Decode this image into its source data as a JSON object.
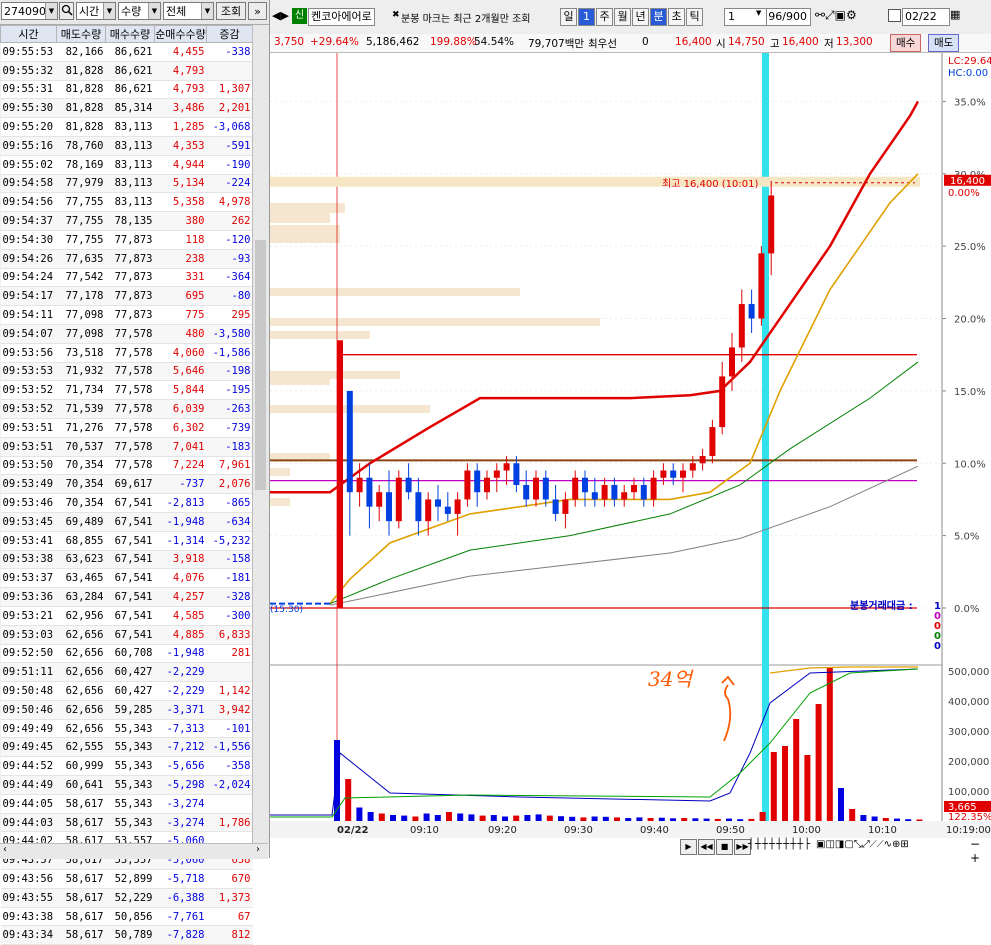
{
  "left_panel": {
    "code": "274090",
    "time_select": "시간",
    "qty_select": "수량",
    "all_select": "전체",
    "query_button": "조회",
    "expand_icon": "»",
    "columns": [
      "시간",
      "매도수량",
      "매수수량",
      "순매수수량",
      "증감"
    ],
    "rows": [
      [
        "09:55:53",
        "82,166",
        "86,621",
        "4,455",
        "-338"
      ],
      [
        "09:55:32",
        "81,828",
        "86,621",
        "4,793",
        ""
      ],
      [
        "09:55:31",
        "81,828",
        "86,621",
        "4,793",
        "1,307"
      ],
      [
        "09:55:30",
        "81,828",
        "85,314",
        "3,486",
        "2,201"
      ],
      [
        "09:55:20",
        "81,828",
        "83,113",
        "1,285",
        "-3,068"
      ],
      [
        "09:55:16",
        "78,760",
        "83,113",
        "4,353",
        "-591"
      ],
      [
        "09:55:02",
        "78,169",
        "83,113",
        "4,944",
        "-190"
      ],
      [
        "09:54:58",
        "77,979",
        "83,113",
        "5,134",
        "-224"
      ],
      [
        "09:54:56",
        "77,755",
        "83,113",
        "5,358",
        "4,978"
      ],
      [
        "09:54:37",
        "77,755",
        "78,135",
        "380",
        "262"
      ],
      [
        "09:54:30",
        "77,755",
        "77,873",
        "118",
        "-120"
      ],
      [
        "09:54:26",
        "77,635",
        "77,873",
        "238",
        "-93"
      ],
      [
        "09:54:24",
        "77,542",
        "77,873",
        "331",
        "-364"
      ],
      [
        "09:54:17",
        "77,178",
        "77,873",
        "695",
        "-80"
      ],
      [
        "09:54:11",
        "77,098",
        "77,873",
        "775",
        "295"
      ],
      [
        "09:54:07",
        "77,098",
        "77,578",
        "480",
        "-3,580"
      ],
      [
        "09:53:56",
        "73,518",
        "77,578",
        "4,060",
        "-1,586"
      ],
      [
        "09:53:53",
        "71,932",
        "77,578",
        "5,646",
        "-198"
      ],
      [
        "09:53:52",
        "71,734",
        "77,578",
        "5,844",
        "-195"
      ],
      [
        "09:53:52",
        "71,539",
        "77,578",
        "6,039",
        "-263"
      ],
      [
        "09:53:51",
        "71,276",
        "77,578",
        "6,302",
        "-739"
      ],
      [
        "09:53:51",
        "70,537",
        "77,578",
        "7,041",
        "-183"
      ],
      [
        "09:53:50",
        "70,354",
        "77,578",
        "7,224",
        "7,961"
      ],
      [
        "09:53:49",
        "70,354",
        "69,617",
        "-737",
        "2,076"
      ],
      [
        "09:53:46",
        "70,354",
        "67,541",
        "-2,813",
        "-865"
      ],
      [
        "09:53:45",
        "69,489",
        "67,541",
        "-1,948",
        "-634"
      ],
      [
        "09:53:41",
        "68,855",
        "67,541",
        "-1,314",
        "-5,232"
      ],
      [
        "09:53:38",
        "63,623",
        "67,541",
        "3,918",
        "-158"
      ],
      [
        "09:53:37",
        "63,465",
        "67,541",
        "4,076",
        "-181"
      ],
      [
        "09:53:36",
        "63,284",
        "67,541",
        "4,257",
        "-328"
      ],
      [
        "09:53:21",
        "62,956",
        "67,541",
        "4,585",
        "-300"
      ],
      [
        "09:53:03",
        "62,656",
        "67,541",
        "4,885",
        "6,833"
      ],
      [
        "09:52:50",
        "62,656",
        "60,708",
        "-1,948",
        "281"
      ],
      [
        "09:51:11",
        "62,656",
        "60,427",
        "-2,229",
        ""
      ],
      [
        "09:50:48",
        "62,656",
        "60,427",
        "-2,229",
        "1,142"
      ],
      [
        "09:50:46",
        "62,656",
        "59,285",
        "-3,371",
        "3,942"
      ],
      [
        "09:49:49",
        "62,656",
        "55,343",
        "-7,313",
        "-101"
      ],
      [
        "09:49:45",
        "62,555",
        "55,343",
        "-7,212",
        "-1,556"
      ],
      [
        "09:44:52",
        "60,999",
        "55,343",
        "-5,656",
        "-358"
      ],
      [
        "09:44:49",
        "60,641",
        "55,343",
        "-5,298",
        "-2,024"
      ],
      [
        "09:44:05",
        "58,617",
        "55,343",
        "-3,274",
        ""
      ],
      [
        "09:44:03",
        "58,617",
        "55,343",
        "-3,274",
        "1,786"
      ],
      [
        "09:44:02",
        "58,617",
        "53,557",
        "-5,060",
        ""
      ],
      [
        "09:43:57",
        "58,617",
        "53,557",
        "-5,060",
        "658"
      ],
      [
        "09:43:56",
        "58,617",
        "52,899",
        "-5,718",
        "670"
      ],
      [
        "09:43:55",
        "58,617",
        "52,229",
        "-6,388",
        "1,373"
      ],
      [
        "09:43:38",
        "58,617",
        "50,856",
        "-7,761",
        "67"
      ],
      [
        "09:43:34",
        "58,617",
        "50,789",
        "-7,828",
        "812"
      ]
    ]
  },
  "toolbar": {
    "credit_badge": "신",
    "stock_name": "켄코아에어로",
    "notice": "분봉 마크는 최근 2개월만 조회",
    "periods": [
      "일",
      "1",
      "주",
      "월",
      "년",
      "분",
      "초",
      "틱"
    ],
    "interval_value": "1",
    "count_value": "96/900",
    "date_value": "02/22"
  },
  "quote": {
    "change": "3,750",
    "change_pct": "+29.64%",
    "volume": "5,186,462",
    "vol_ratio": "199.88%",
    "turnover": "54.54%",
    "amount": "79,707백만",
    "priority_label": "최우선",
    "priority_value": "0",
    "current": "16,400",
    "open_label": "시",
    "open": "14,750",
    "high_label": "고",
    "high": "16,400",
    "low_label": "저",
    "low": "13,300",
    "buy_button": "매수",
    "sell_button": "매도"
  },
  "chart": {
    "lc_label": "LC:29.64",
    "hc_label": "HC:0.00",
    "high_annotation": "최고 16,400 (10:01)",
    "price_tag": "16,400",
    "price_tag_pct": "0.00%",
    "prev_close_marker": "(15:30)",
    "amount_legend_title": "분봉거래대금 :",
    "amount_legend_values": [
      "1",
      "0",
      "0",
      "0",
      "0"
    ],
    "handwritten_note": "34억",
    "vol_tag": "3,665",
    "vol_tag_pct": "122.35%"
  },
  "chart_data": [
    {
      "type": "candlestick",
      "y_axis_ticks": [
        "35.0%",
        "30.0%",
        "25.0%",
        "20.0%",
        "15.0%",
        "10.0%",
        "5.0%",
        "0.0%"
      ],
      "ylim_pct": [
        0,
        38
      ],
      "x_ticks": [
        "02/22",
        "09:10",
        "09:20",
        "09:30",
        "09:40",
        "09:50",
        "10:00",
        "10:10"
      ],
      "candles_pct": [
        [
          0,
          15,
          0,
          18.5
        ],
        [
          15,
          12,
          5,
          8
        ],
        [
          8,
          10,
          7,
          9
        ],
        [
          9,
          10,
          5.5,
          7
        ],
        [
          7,
          8.5,
          6,
          8
        ],
        [
          8,
          9.5,
          5,
          6
        ],
        [
          6,
          9.5,
          5.5,
          9
        ],
        [
          9,
          10,
          7.5,
          8
        ],
        [
          8,
          9,
          5,
          6
        ],
        [
          6,
          8,
          5,
          7.5
        ],
        [
          7.5,
          8.5,
          6,
          7
        ],
        [
          7,
          8,
          6,
          6.5
        ],
        [
          6.5,
          8,
          5,
          7.5
        ],
        [
          7.5,
          10,
          7,
          9.5
        ],
        [
          9.5,
          10,
          7,
          8
        ],
        [
          8,
          9.5,
          7.5,
          9
        ],
        [
          9,
          10,
          8,
          9.5
        ],
        [
          9.5,
          10.5,
          8.5,
          10
        ],
        [
          10,
          10.5,
          8,
          8.5
        ],
        [
          8.5,
          9.5,
          7,
          7.5
        ],
        [
          7.5,
          9.5,
          7,
          9
        ],
        [
          9,
          9.5,
          7,
          7.5
        ],
        [
          7.5,
          8.5,
          6,
          6.5
        ],
        [
          6.5,
          8,
          5.5,
          7.5
        ],
        [
          7.5,
          9.5,
          7,
          9
        ],
        [
          9,
          9.5,
          7,
          8
        ],
        [
          8,
          9,
          7,
          7.5
        ],
        [
          7.5,
          9,
          7,
          8.5
        ],
        [
          8.5,
          9,
          7,
          7.5
        ],
        [
          7.5,
          8.5,
          7,
          8
        ],
        [
          8,
          9,
          7.5,
          8.5
        ],
        [
          8.5,
          9,
          7,
          7.5
        ],
        [
          7.5,
          9.5,
          7,
          9
        ],
        [
          9,
          10,
          8.5,
          9.5
        ],
        [
          9.5,
          10,
          8.5,
          9
        ],
        [
          9,
          10,
          8,
          9.5
        ],
        [
          9.5,
          10.5,
          9,
          10
        ],
        [
          10,
          11,
          9.5,
          10.5
        ],
        [
          10.5,
          13,
          10,
          12.5
        ],
        [
          12.5,
          17,
          12,
          16
        ],
        [
          16,
          19,
          15,
          18
        ],
        [
          18,
          22,
          17,
          21
        ],
        [
          21,
          22,
          19,
          20
        ],
        [
          20,
          25,
          19.5,
          24.5
        ],
        [
          24.5,
          29.5,
          23,
          28.5
        ]
      ],
      "series": [
        {
          "name": "ma5",
          "color": "#e00000"
        },
        {
          "name": "ma20",
          "color": "#e0a000"
        },
        {
          "name": "ma60",
          "color": "#008000"
        },
        {
          "name": "ma120",
          "color": "#808080"
        }
      ],
      "hlines_pct": [
        {
          "y": 17.5,
          "color": "#e00000"
        },
        {
          "y": 10.2,
          "color": "#8b4513"
        },
        {
          "y": 8.8,
          "color": "#c000c0"
        },
        {
          "y": 0,
          "color": "#e00000"
        }
      ]
    },
    {
      "type": "bar",
      "y_axis_ticks": [
        "500,000",
        "400,000",
        "300,000",
        "200,000",
        "100,000"
      ],
      "ylim": [
        0,
        520000
      ],
      "values": [
        270000,
        140000,
        45000,
        30000,
        25000,
        20000,
        18000,
        15000,
        25000,
        20000,
        30000,
        25000,
        22000,
        18000,
        20000,
        15000,
        18000,
        20000,
        22000,
        18000,
        16000,
        14000,
        12000,
        15000,
        14000,
        12000,
        10000,
        12000,
        10000,
        11000,
        9000,
        10000,
        9000,
        8000,
        7000,
        8000,
        6000,
        7000,
        30000,
        230000,
        250000,
        340000,
        220000,
        390000,
        510000,
        110000,
        40000,
        20000,
        15000,
        10000,
        8000,
        6000,
        5000
      ],
      "colors": "red=up blue=down"
    }
  ],
  "time_axis_end": "10:19:00"
}
